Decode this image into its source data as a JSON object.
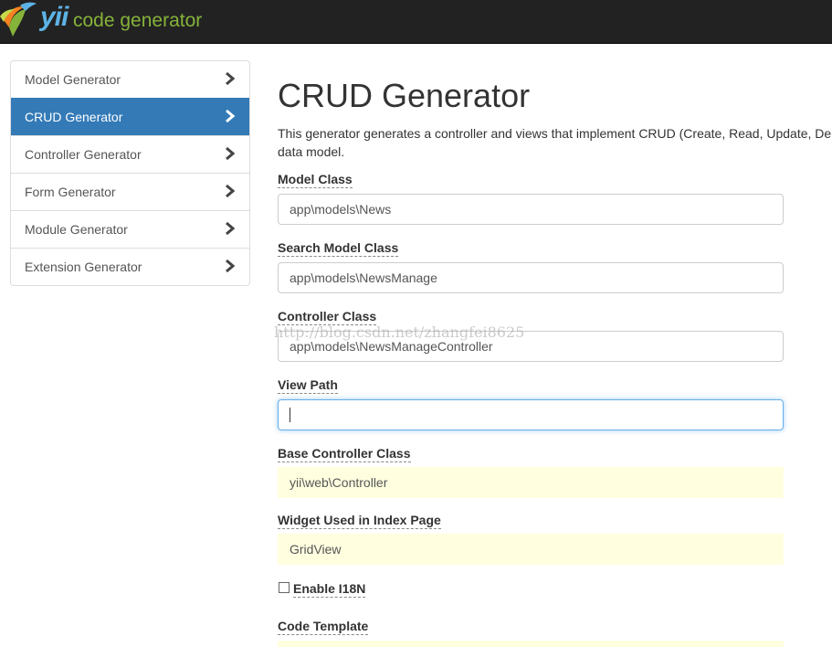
{
  "brand": {
    "logo_text": "yii",
    "subtitle": "code generator",
    "colors": {
      "green": "#86b33a",
      "blue": "#5db3e6",
      "orange": "#f58220",
      "navbar": "#222222"
    }
  },
  "sidebar": {
    "items": [
      {
        "label": "Model Generator",
        "active": false
      },
      {
        "label": "CRUD Generator",
        "active": true
      },
      {
        "label": "Controller Generator",
        "active": false
      },
      {
        "label": "Form Generator",
        "active": false
      },
      {
        "label": "Module Generator",
        "active": false
      },
      {
        "label": "Extension Generator",
        "active": false
      }
    ],
    "icon": "chevron-right-icon",
    "active_color": "#337ab7"
  },
  "main": {
    "title": "CRUD Generator",
    "description_line1": "This generator generates a controller and views that implement CRUD (Create, Read, Update, De",
    "description_line2": "data model.",
    "fields": {
      "model_class": {
        "label": "Model Class",
        "value": "app\\models\\News"
      },
      "search_model_class": {
        "label": "Search Model Class",
        "value": "app\\models\\NewsManage"
      },
      "controller_class": {
        "label": "Controller Class",
        "value": "app\\models\\NewsManageController"
      },
      "view_path": {
        "label": "View Path",
        "value": ""
      },
      "base_controller_class": {
        "label": "Base Controller Class",
        "value": "yii\\web\\Controller"
      },
      "index_widget": {
        "label": "Widget Used in Index Page",
        "value": "GridView"
      },
      "enable_i18n": {
        "label": "Enable I18N",
        "checked": false
      },
      "code_template": {
        "label": "Code Template"
      }
    },
    "sticky_color": "#ffffe0"
  },
  "watermark": "http://blog.csdn.net/zhangfei8625"
}
